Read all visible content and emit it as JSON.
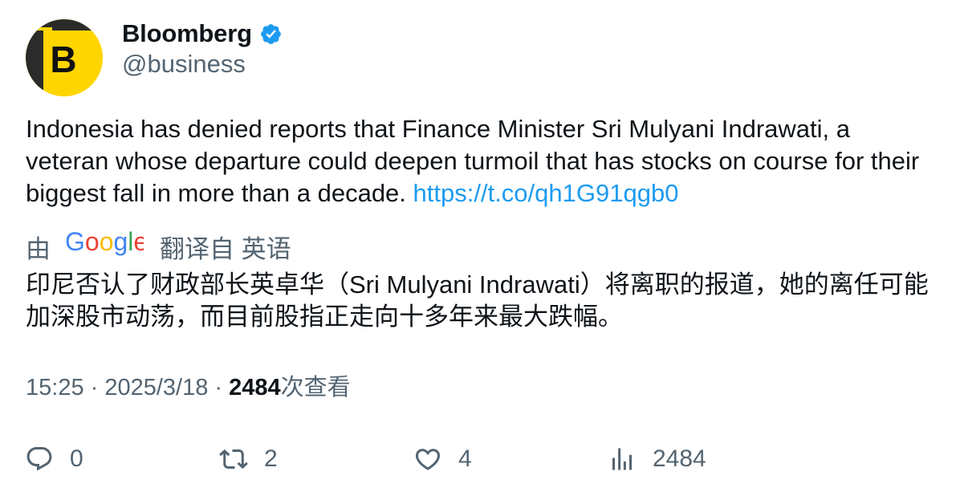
{
  "author": {
    "name": "Bloomberg",
    "handle": "@business",
    "avatar_letter": "B",
    "avatar_color": "#ffd500",
    "verified": true,
    "verified_color": "#1d9bf0"
  },
  "tweet": {
    "text": "Indonesia has denied reports that Finance Minister Sri Mulyani Indrawati, a veteran whose departure could deepen turmoil that has stocks on course for their biggest fall in more than a decade. ",
    "link": "https://t.co/qh1G91qgb0",
    "link_color": "#1d9bf0"
  },
  "translation": {
    "prefix": "由",
    "provider_logo": "Google",
    "suffix": "翻译自 英语",
    "text": "印尼否认了财政部长英卓华（Sri Mulyani Indrawati）将离职的报道，她的离任可能加深股市动荡，而目前股指正走向十多年来最大跌幅。"
  },
  "meta": {
    "time": "15:25",
    "separator1": " · ",
    "date": "2025/3/18",
    "separator2": " · ",
    "views_count": "2484",
    "views_label": "次查看"
  },
  "actions": {
    "reply": {
      "icon": "reply-icon",
      "count": "0"
    },
    "retweet": {
      "icon": "retweet-icon",
      "count": "2"
    },
    "like": {
      "icon": "heart-icon",
      "count": "4"
    },
    "views": {
      "icon": "analytics-icon",
      "count": "2484"
    }
  }
}
